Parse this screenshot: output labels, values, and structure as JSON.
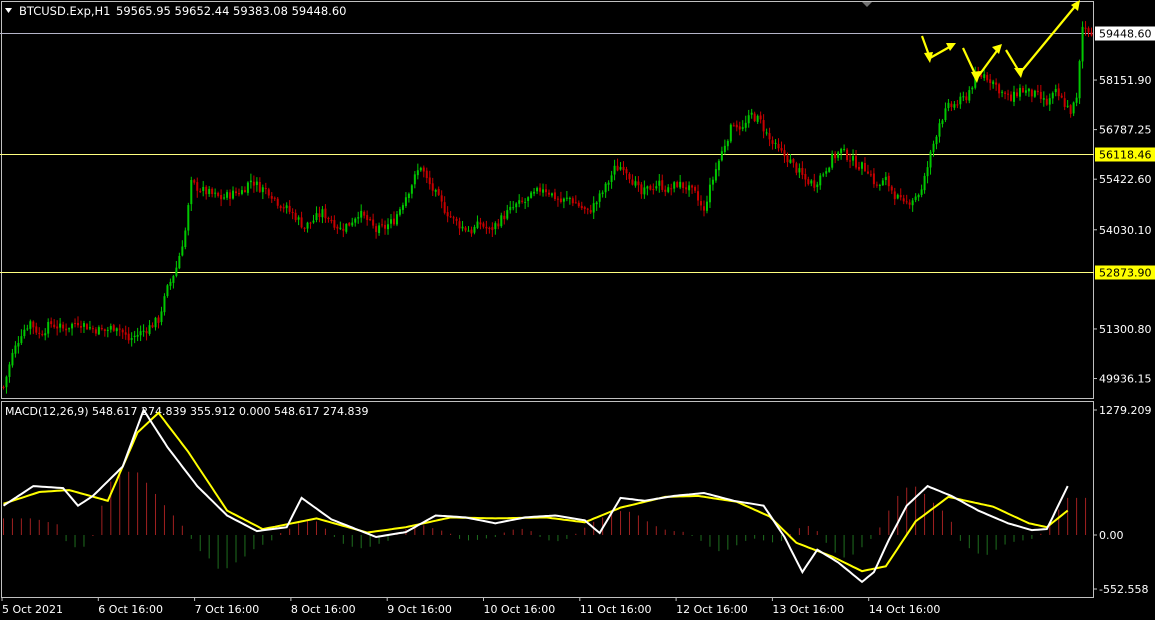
{
  "header": {
    "symbol": "BTCUSD.Exp,H1",
    "ohlc": "59565.95 59652.44 59383.08 59448.60"
  },
  "price_axis": {
    "ticks": [
      "58151.90",
      "56787.25",
      "55422.60",
      "54030.10",
      "51300.80",
      "49936.15"
    ],
    "current_price": "59448.60",
    "levels": [
      "56118.46",
      "52873.90"
    ]
  },
  "macd": {
    "label": "MACD(12,26,9) 548.617 274.839 355.912 0.000 548.617 274.839",
    "ticks": [
      "1279.209",
      "0.00",
      "-552.558"
    ]
  },
  "time_axis": {
    "labels": [
      "5 Oct 2021",
      "6 Oct 16:00",
      "7 Oct 16:00",
      "8 Oct 16:00",
      "9 Oct 16:00",
      "10 Oct 16:00",
      "11 Oct 16:00",
      "12 Oct 16:00",
      "13 Oct 16:00",
      "14 Oct 16:00"
    ]
  },
  "colors": {
    "background": "#000000",
    "bull": "#00c800",
    "bear": "#c80000",
    "level_line": "#ffff80",
    "current_line": "#b4b4c8",
    "macd_main": "#ffffff",
    "macd_signal": "#ffff00",
    "hist_pos": "#a02020",
    "hist_neg": "#1e6e1e",
    "arrows": "#ffff00",
    "axis": "#c0c0c0"
  },
  "chart_data": [
    {
      "type": "candlestick",
      "title": "BTCUSD.Exp,H1",
      "ylim": [
        49400,
        60300
      ],
      "levels": [
        59448.6,
        56118.46,
        52873.9
      ],
      "close_path": [
        [
          0,
          49700
        ],
        [
          3,
          50600
        ],
        [
          6,
          51200
        ],
        [
          9,
          51500
        ],
        [
          12,
          51150
        ],
        [
          16,
          51450
        ],
        [
          20,
          51300
        ],
        [
          25,
          51500
        ],
        [
          30,
          51300
        ],
        [
          34,
          51250
        ],
        [
          38,
          51400
        ],
        [
          41,
          51100
        ],
        [
          42,
          51000
        ],
        [
          45,
          51150
        ],
        [
          48,
          51300
        ],
        [
          52,
          51550
        ],
        [
          55,
          52400
        ],
        [
          58,
          53000
        ],
        [
          61,
          54000
        ],
        [
          63,
          55300
        ],
        [
          67,
          55100
        ],
        [
          70,
          55000
        ],
        [
          73,
          54900
        ],
        [
          76,
          55000
        ],
        [
          80,
          55100
        ],
        [
          83,
          55400
        ],
        [
          86,
          55200
        ],
        [
          89,
          55100
        ],
        [
          92,
          54800
        ],
        [
          95,
          54600
        ],
        [
          98,
          54400
        ],
        [
          101,
          54100
        ],
        [
          104,
          54300
        ],
        [
          107,
          54500
        ],
        [
          110,
          54300
        ],
        [
          113,
          54050
        ],
        [
          116,
          54200
        ],
        [
          119,
          54500
        ],
        [
          122,
          54300
        ],
        [
          125,
          54000
        ],
        [
          128,
          54100
        ],
        [
          131,
          54300
        ],
        [
          134,
          54800
        ],
        [
          137,
          55300
        ],
        [
          140,
          55800
        ],
        [
          142,
          55400
        ],
        [
          145,
          55000
        ],
        [
          148,
          54600
        ],
        [
          151,
          54300
        ],
        [
          154,
          54100
        ],
        [
          157,
          54000
        ],
        [
          160,
          54200
        ],
        [
          163,
          54000
        ],
        [
          166,
          54250
        ],
        [
          169,
          54500
        ],
        [
          172,
          54700
        ],
        [
          175,
          54800
        ],
        [
          178,
          55000
        ],
        [
          181,
          55200
        ],
        [
          184,
          55000
        ],
        [
          187,
          54800
        ],
        [
          190,
          54900
        ],
        [
          193,
          54700
        ],
        [
          196,
          54500
        ],
        [
          199,
          54800
        ],
        [
          202,
          55200
        ],
        [
          205,
          55700
        ],
        [
          208,
          55800
        ],
        [
          211,
          55400
        ],
        [
          214,
          55000
        ],
        [
          217,
          55200
        ],
        [
          220,
          55300
        ],
        [
          223,
          55100
        ],
        [
          226,
          55300
        ],
        [
          229,
          55200
        ],
        [
          232,
          55000
        ],
        [
          235,
          54500
        ],
        [
          236,
          54900
        ],
        [
          239,
          55700
        ],
        [
          242,
          56400
        ],
        [
          245,
          57000
        ],
        [
          248,
          56800
        ],
        [
          251,
          57200
        ],
        [
          254,
          57000
        ],
        [
          257,
          56500
        ],
        [
          260,
          56200
        ],
        [
          263,
          56000
        ],
        [
          266,
          55700
        ],
        [
          269,
          55400
        ],
        [
          272,
          55300
        ],
        [
          275,
          55600
        ],
        [
          278,
          56000
        ],
        [
          281,
          56200
        ],
        [
          284,
          56000
        ],
        [
          287,
          55800
        ],
        [
          290,
          55700
        ],
        [
          293,
          55200
        ],
        [
          296,
          55400
        ],
        [
          299,
          55000
        ],
        [
          302,
          54700
        ],
        [
          305,
          54900
        ],
        [
          308,
          55100
        ],
        [
          311,
          56100
        ],
        [
          314,
          57000
        ],
        [
          317,
          57400
        ],
        [
          320,
          57500
        ],
        [
          323,
          57700
        ],
        [
          326,
          58200
        ],
        [
          329,
          58300
        ],
        [
          332,
          58100
        ],
        [
          335,
          57800
        ],
        [
          338,
          57600
        ],
        [
          341,
          57900
        ],
        [
          344,
          57800
        ],
        [
          347,
          57700
        ],
        [
          350,
          57500
        ],
        [
          353,
          57800
        ],
        [
          356,
          57500
        ],
        [
          358,
          57300
        ],
        [
          360,
          57600
        ],
        [
          362,
          59600
        ],
        [
          365,
          59500
        ]
      ]
    },
    {
      "type": "line",
      "title": "MACD(12,26,9)",
      "ylim": [
        -552.558,
        1279.209
      ],
      "series": [
        {
          "name": "MACD main",
          "points": [
            [
              0,
              300
            ],
            [
              10,
              500
            ],
            [
              20,
              480
            ],
            [
              25,
              300
            ],
            [
              30,
              400
            ],
            [
              40,
              700
            ],
            [
              47,
              1279
            ],
            [
              55,
              900
            ],
            [
              65,
              500
            ],
            [
              75,
              200
            ],
            [
              85,
              40
            ],
            [
              95,
              80
            ],
            [
              100,
              380
            ],
            [
              110,
              160
            ],
            [
              125,
              -20
            ],
            [
              135,
              30
            ],
            [
              145,
              200
            ],
            [
              155,
              180
            ],
            [
              165,
              120
            ],
            [
              175,
              180
            ],
            [
              185,
              200
            ],
            [
              195,
              150
            ],
            [
              200,
              20
            ],
            [
              207,
              380
            ],
            [
              215,
              350
            ],
            [
              225,
              400
            ],
            [
              235,
              430
            ],
            [
              245,
              350
            ],
            [
              255,
              300
            ],
            [
              262,
              -20
            ],
            [
              268,
              -380
            ],
            [
              273,
              -150
            ],
            [
              280,
              -280
            ],
            [
              288,
              -480
            ],
            [
              292,
              -380
            ],
            [
              297,
              -50
            ],
            [
              303,
              300
            ],
            [
              310,
              500
            ],
            [
              318,
              400
            ],
            [
              327,
              250
            ],
            [
              337,
              120
            ],
            [
              345,
              50
            ],
            [
              350,
              60
            ],
            [
              357,
              500
            ]
          ]
        },
        {
          "name": "Signal",
          "points": [
            [
              0,
              320
            ],
            [
              12,
              440
            ],
            [
              22,
              460
            ],
            [
              35,
              350
            ],
            [
              45,
              1050
            ],
            [
              52,
              1250
            ],
            [
              62,
              850
            ],
            [
              75,
              250
            ],
            [
              87,
              60
            ],
            [
              105,
              170
            ],
            [
              122,
              25
            ],
            [
              135,
              80
            ],
            [
              150,
              180
            ],
            [
              165,
              170
            ],
            [
              182,
              180
            ],
            [
              195,
              130
            ],
            [
              207,
              280
            ],
            [
              222,
              390
            ],
            [
              233,
              400
            ],
            [
              246,
              340
            ],
            [
              257,
              190
            ],
            [
              266,
              -80
            ],
            [
              278,
              -220
            ],
            [
              288,
              -370
            ],
            [
              296,
              -320
            ],
            [
              306,
              140
            ],
            [
              317,
              390
            ],
            [
              332,
              290
            ],
            [
              344,
              120
            ],
            [
              350,
              80
            ],
            [
              357,
              250
            ]
          ]
        },
        {
          "name": "Histogram",
          "type": "bar",
          "points": [
            [
              2,
              170
            ],
            [
              6,
              170
            ],
            [
              10,
              170
            ],
            [
              14,
              140
            ],
            [
              18,
              110
            ],
            [
              22,
              -120
            ],
            [
              26,
              -130
            ],
            [
              29,
              -100
            ],
            [
              33,
              300
            ],
            [
              37,
              630
            ],
            [
              41,
              650
            ],
            [
              45,
              640
            ],
            [
              49,
              500
            ],
            [
              53,
              340
            ],
            [
              57,
              200
            ],
            [
              61,
              60
            ],
            [
              65,
              -140
            ],
            [
              69,
              -240
            ],
            [
              73,
              -380
            ],
            [
              77,
              -300
            ],
            [
              81,
              -220
            ],
            [
              85,
              -120
            ],
            [
              89,
              -80
            ],
            [
              93,
              20
            ],
            [
              97,
              80
            ],
            [
              101,
              160
            ],
            [
              105,
              140
            ],
            [
              109,
              40
            ],
            [
              113,
              -80
            ],
            [
              117,
              -120
            ],
            [
              121,
              -140
            ],
            [
              125,
              -100
            ],
            [
              129,
              -60
            ],
            [
              133,
              40
            ],
            [
              137,
              80
            ],
            [
              141,
              100
            ],
            [
              145,
              60
            ],
            [
              149,
              30
            ],
            [
              153,
              -40
            ],
            [
              157,
              -60
            ],
            [
              161,
              -40
            ],
            [
              165,
              -20
            ],
            [
              169,
              40
            ],
            [
              173,
              70
            ],
            [
              177,
              40
            ],
            [
              181,
              -40
            ],
            [
              185,
              -70
            ],
            [
              189,
              -40
            ],
            [
              193,
              30
            ],
            [
              197,
              120
            ],
            [
              201,
              180
            ],
            [
              205,
              240
            ],
            [
              209,
              250
            ],
            [
              213,
              200
            ],
            [
              217,
              120
            ],
            [
              221,
              60
            ],
            [
              225,
              40
            ],
            [
              229,
              30
            ],
            [
              233,
              -40
            ],
            [
              237,
              -120
            ],
            [
              241,
              -180
            ],
            [
              245,
              -120
            ],
            [
              249,
              -60
            ],
            [
              253,
              -30
            ],
            [
              257,
              -80
            ],
            [
              261,
              -60
            ],
            [
              265,
              30
            ],
            [
              269,
              110
            ],
            [
              273,
              40
            ],
            [
              277,
              -120
            ],
            [
              281,
              -240
            ],
            [
              285,
              -200
            ],
            [
              289,
              -100
            ],
            [
              293,
              20
            ],
            [
              297,
              250
            ],
            [
              301,
              450
            ],
            [
              305,
              520
            ],
            [
              309,
              420
            ],
            [
              313,
              300
            ],
            [
              317,
              200
            ],
            [
              321,
              -60
            ],
            [
              325,
              -160
            ],
            [
              329,
              -220
            ],
            [
              333,
              -150
            ],
            [
              337,
              -80
            ],
            [
              341,
              -60
            ],
            [
              345,
              -40
            ],
            [
              349,
              30
            ],
            [
              353,
              220
            ],
            [
              357,
              380
            ]
          ]
        }
      ]
    }
  ]
}
